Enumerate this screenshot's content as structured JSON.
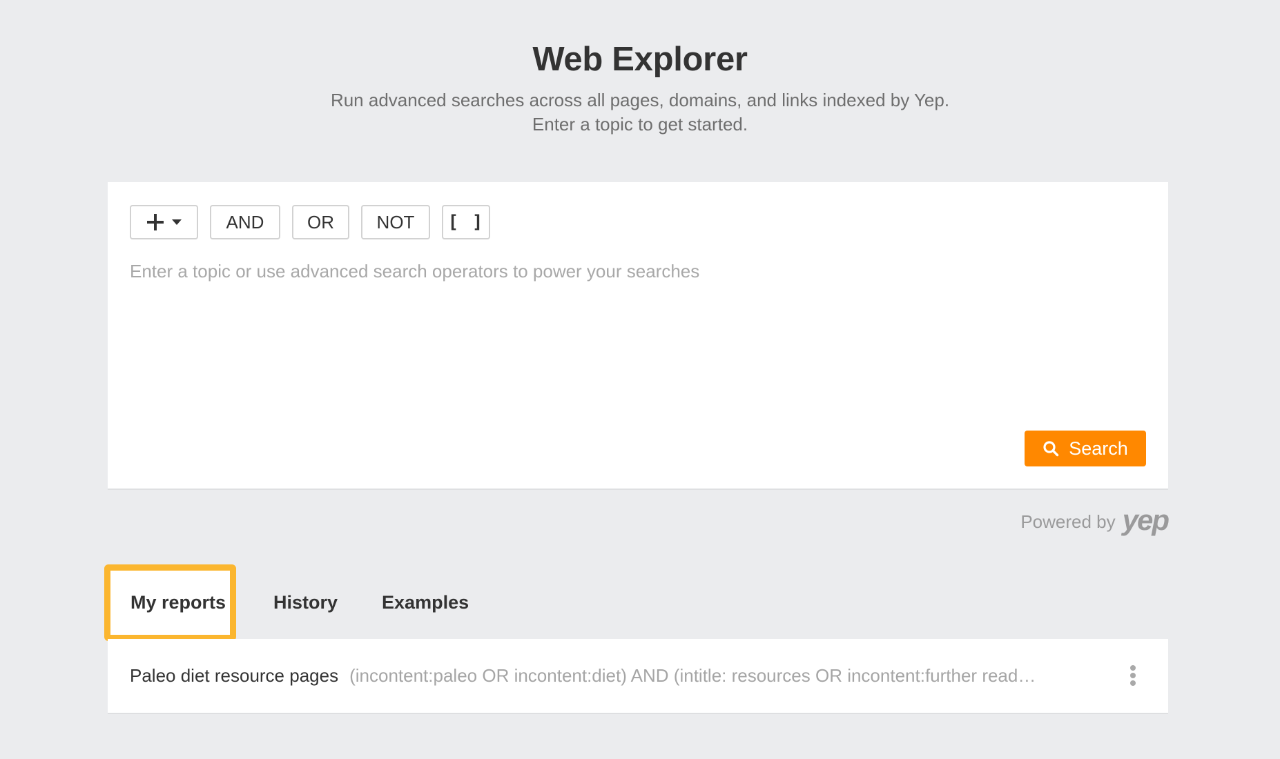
{
  "header": {
    "title": "Web Explorer",
    "subtitle_line1": "Run advanced searches across all pages, domains, and links indexed by Yep.",
    "subtitle_line2": "Enter a topic to get started."
  },
  "search_panel": {
    "operators": {
      "add_icon": "plus-icon",
      "add_caret_icon": "caret-down-icon",
      "and_label": "AND",
      "or_label": "OR",
      "not_label": "NOT",
      "brackets_label": "[ ]"
    },
    "query_value": "",
    "query_placeholder": "Enter a topic or use advanced search operators to power your searches",
    "search_button_label": "Search",
    "search_button_icon": "search-icon",
    "accent_color": "#ff8800"
  },
  "powered_by": {
    "label": "Powered by",
    "logo_text": "yep"
  },
  "tabs": [
    {
      "label": "My reports",
      "active": true
    },
    {
      "label": "History",
      "active": false
    },
    {
      "label": "Examples",
      "active": false
    }
  ],
  "highlight_color": "#fbb62f",
  "reports": [
    {
      "name": "Paleo diet resource pages",
      "query": "(incontent:paleo OR incontent:diet) AND (intitle: resources OR incontent:further read…",
      "menu_icon": "kebab-menu-icon"
    }
  ]
}
